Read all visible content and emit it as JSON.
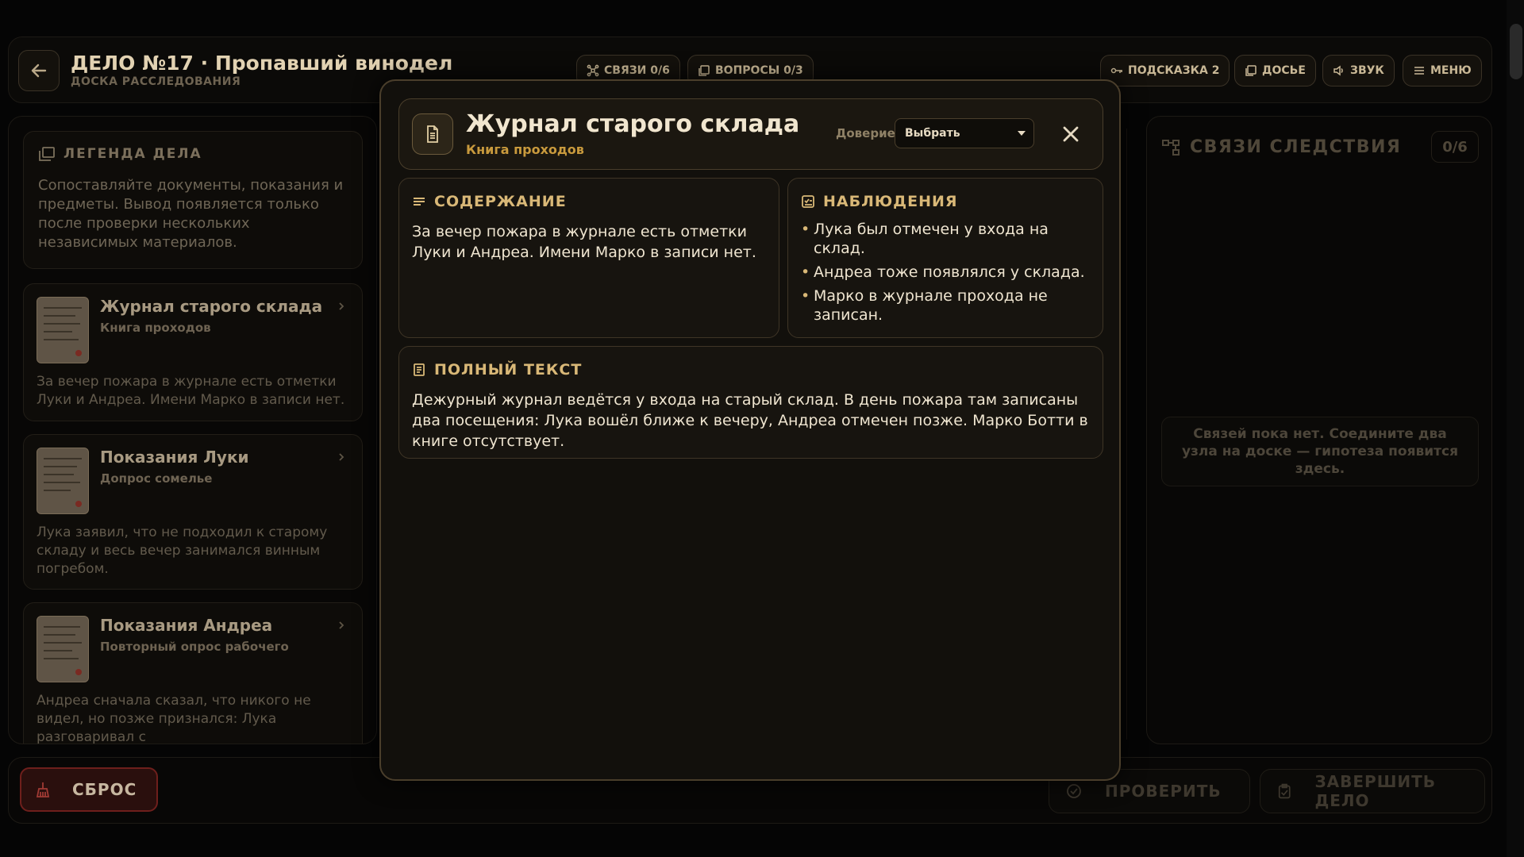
{
  "header": {
    "case_title": "ДЕЛО №17 · Пропавший винодел",
    "case_sub": "ДОСКА РАССЛЕДОВАНИЯ",
    "links_pill": "СВЯЗИ 0/6",
    "questions_pill": "ВОПРОСЫ 0/3",
    "hint_pill": "ПОДСКАЗКА 2",
    "dossier_pill": "ДОСЬЕ",
    "sound_pill": "ЗВУК",
    "menu_pill": "МЕНЮ"
  },
  "legend": {
    "title": "ЛЕГЕНДА ДЕЛА",
    "text": "Сопоставляйте документы, показания и предметы. Вывод появляется только после проверки нескольких независимых материалов."
  },
  "documents": [
    {
      "title": "Журнал старого склада",
      "subtitle": "Книга проходов",
      "desc": "За вечер пожара в журнале есть отметки Луки и Андреа. Имени Марко в записи нет."
    },
    {
      "title": "Показания Луки",
      "subtitle": "Допрос сомелье",
      "desc": "Лука заявил, что не подходил к старому складу и весь вечер занимался винным погребом."
    },
    {
      "title": "Показания Андреа",
      "subtitle": "Повторный опрос рабочего",
      "desc": "Андреа сначала сказал, что никого не видел, но позже признался: Лука разговаривал с"
    }
  ],
  "links_panel": {
    "title": "СВЯЗИ СЛЕДСТВИЯ",
    "count": "0/6",
    "empty": "Связей пока нет. Соедините два узла на доске — гипотеза появится здесь."
  },
  "bottom": {
    "reset": "СБРОС",
    "check": "ПРОВЕРИТЬ",
    "finish": "ЗАВЕРШИТЬ ДЕЛО"
  },
  "modal": {
    "title": "Журнал старого склада",
    "subtitle": "Книга проходов",
    "trust_label": "Доверие",
    "trust_value": "Выбрать",
    "content_head": "СОДЕРЖАНИЕ",
    "content_text": "За вечер пожара в журнале есть отметки Луки и Андреа. Имени Марко в записи нет.",
    "obs_head": "НАБЛЮДЕНИЯ",
    "observations": [
      "Лука был отмечен у входа на склад.",
      "Андреа тоже появлялся у склада.",
      "Марко в журнале прохода не записан."
    ],
    "fulltext_head": "ПОЛНЫЙ ТЕКСТ",
    "fulltext": "Дежурный журнал ведётся у входа на старый склад. В день пожара там записаны два посещения: Лука вошёл ближе к вечеру, Андреа отмечен позже. Марко Ботти в книге отсутствует."
  },
  "colors": {
    "accent_gold": "#d9b877",
    "subtitle_orange": "#c99a3d",
    "reset_red": "#6e1f1c"
  }
}
